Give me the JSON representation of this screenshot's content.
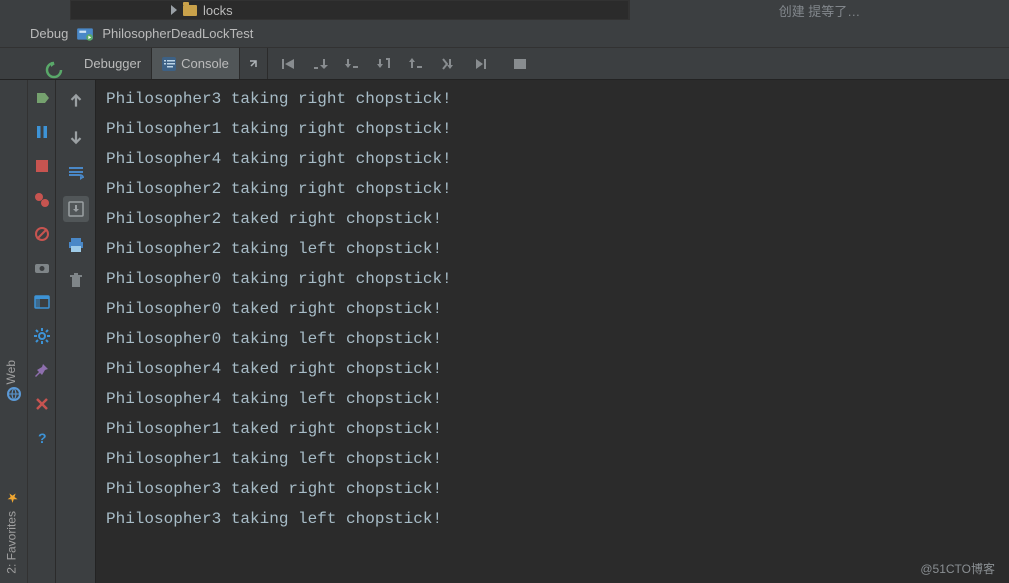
{
  "project": {
    "tree_item": "locks",
    "right_hint": "创建   提等了…"
  },
  "debug": {
    "label": "Debug",
    "config_name": "PhilosopherDeadLockTest"
  },
  "tabs": {
    "debugger": "Debugger",
    "console": "Console"
  },
  "console_output": [
    "Philosopher3 taking right chopstick!",
    "Philosopher1 taking right chopstick!",
    "Philosopher4 taking right chopstick!",
    "Philosopher2 taking right chopstick!",
    "Philosopher2 taked right chopstick!",
    "Philosopher2 taking left chopstick!",
    "Philosopher0 taking right chopstick!",
    "Philosopher0 taked right chopstick!",
    "Philosopher0 taking left chopstick!",
    "Philosopher4 taked right chopstick!",
    "Philosopher4 taking left chopstick!",
    "Philosopher1 taked right chopstick!",
    "Philosopher1 taking left chopstick!",
    "Philosopher3 taked right chopstick!",
    "Philosopher3 taking left chopstick!"
  ],
  "left_rail": {
    "step_over": "step-over",
    "pause": "pause",
    "stop": "stop",
    "breakpoints": "breakpoints",
    "mute": "mute-breakpoints",
    "camera": "get-thread-dump",
    "settings": "settings",
    "pin": "pin",
    "close": "close",
    "help": "help"
  },
  "gutter": {
    "up": "scroll-up",
    "down": "scroll-down",
    "wrap": "soft-wrap",
    "scroll_end": "scroll-to-end",
    "print": "print",
    "clear": "clear-all"
  },
  "side": {
    "web": "Web",
    "favorites": "2: Favorites"
  },
  "watermark": "@51CTO博客"
}
